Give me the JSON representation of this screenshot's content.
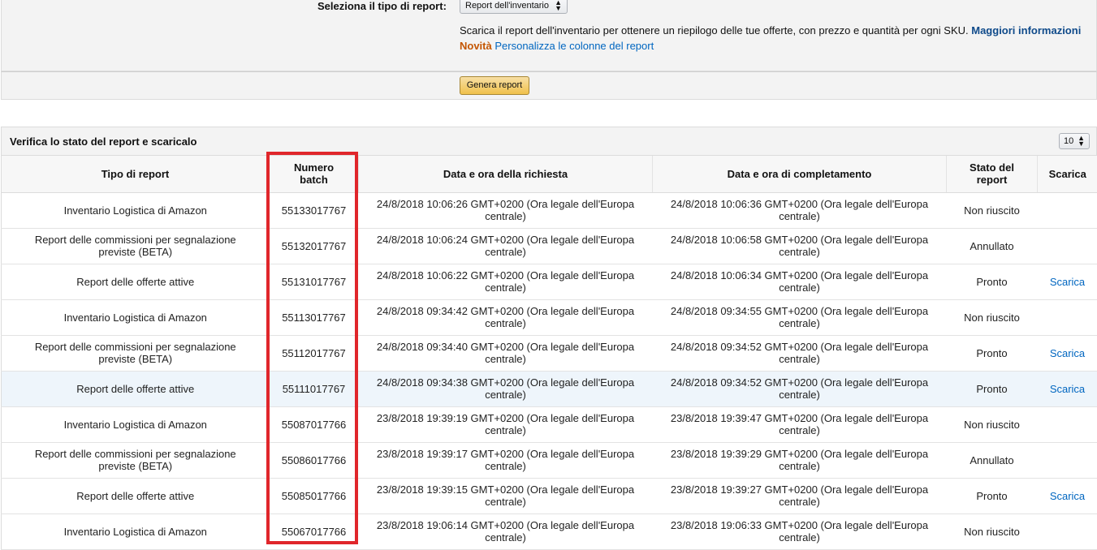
{
  "form": {
    "type_label": "Seleziona il tipo di report:",
    "type_select_value": "Report dell'inventario",
    "description": "Scarica il report dell'inventario per ottenere un riepilogo delle tue offerte, con prezzo e quantità per ogni SKU.",
    "more_info_link": "Maggiori informazioni",
    "new_badge": "Novità",
    "customize_link": "Personalizza le colonne del report",
    "generate_button": "Genera report"
  },
  "status_section": {
    "title": "Verifica lo stato del report e scaricalo",
    "page_size": "10"
  },
  "table": {
    "columns": {
      "type": "Tipo di report",
      "batch": "Numero batch",
      "requested": "Data e ora della richiesta",
      "completed": "Data e ora di completamento",
      "status": "Stato del report",
      "download": "Scarica"
    },
    "rows": [
      {
        "type": "Inventario Logistica di Amazon",
        "batch": "55133017767",
        "requested": "24/8/2018 10:06:26 GMT+0200 (Ora legale dell'Europa centrale)",
        "completed": "24/8/2018 10:06:36 GMT+0200 (Ora legale dell'Europa centrale)",
        "status": "Non riuscito",
        "download": ""
      },
      {
        "type": "Report delle commissioni per segnalazione previste (BETA)",
        "batch": "55132017767",
        "requested": "24/8/2018 10:06:24 GMT+0200 (Ora legale dell'Europa centrale)",
        "completed": "24/8/2018 10:06:58 GMT+0200 (Ora legale dell'Europa centrale)",
        "status": "Annullato",
        "download": ""
      },
      {
        "type": "Report delle offerte attive",
        "batch": "55131017767",
        "requested": "24/8/2018 10:06:22 GMT+0200 (Ora legale dell'Europa centrale)",
        "completed": "24/8/2018 10:06:34 GMT+0200 (Ora legale dell'Europa centrale)",
        "status": "Pronto",
        "download": "Scarica"
      },
      {
        "type": "Inventario Logistica di Amazon",
        "batch": "55113017767",
        "requested": "24/8/2018 09:34:42 GMT+0200 (Ora legale dell'Europa centrale)",
        "completed": "24/8/2018 09:34:55 GMT+0200 (Ora legale dell'Europa centrale)",
        "status": "Non riuscito",
        "download": ""
      },
      {
        "type": "Report delle commissioni per segnalazione previste (BETA)",
        "batch": "55112017767",
        "requested": "24/8/2018 09:34:40 GMT+0200 (Ora legale dell'Europa centrale)",
        "completed": "24/8/2018 09:34:52 GMT+0200 (Ora legale dell'Europa centrale)",
        "status": "Pronto",
        "download": "Scarica"
      },
      {
        "type": "Report delle offerte attive",
        "batch": "55111017767",
        "requested": "24/8/2018 09:34:38 GMT+0200 (Ora legale dell'Europa centrale)",
        "completed": "24/8/2018 09:34:52 GMT+0200 (Ora legale dell'Europa centrale)",
        "status": "Pronto",
        "download": "Scarica"
      },
      {
        "type": "Inventario Logistica di Amazon",
        "batch": "55087017766",
        "requested": "23/8/2018 19:39:19 GMT+0200 (Ora legale dell'Europa centrale)",
        "completed": "23/8/2018 19:39:47 GMT+0200 (Ora legale dell'Europa centrale)",
        "status": "Non riuscito",
        "download": ""
      },
      {
        "type": "Report delle commissioni per segnalazione previste (BETA)",
        "batch": "55086017766",
        "requested": "23/8/2018 19:39:17 GMT+0200 (Ora legale dell'Europa centrale)",
        "completed": "23/8/2018 19:39:29 GMT+0200 (Ora legale dell'Europa centrale)",
        "status": "Annullato",
        "download": ""
      },
      {
        "type": "Report delle offerte attive",
        "batch": "55085017766",
        "requested": "23/8/2018 19:39:15 GMT+0200 (Ora legale dell'Europa centrale)",
        "completed": "23/8/2018 19:39:27 GMT+0200 (Ora legale dell'Europa centrale)",
        "status": "Pronto",
        "download": "Scarica"
      },
      {
        "type": "Inventario Logistica di Amazon",
        "batch": "55067017766",
        "requested": "23/8/2018 19:06:14 GMT+0200 (Ora legale dell'Europa centrale)",
        "completed": "23/8/2018 19:06:33 GMT+0200 (Ora legale dell'Europa centrale)",
        "status": "Non riuscito",
        "download": ""
      }
    ]
  },
  "icons": {
    "select_arrows": "up-down-arrows-icon"
  },
  "colors": {
    "link": "#0066c0",
    "new_badge": "#c45500",
    "primary_button": "#f0c14b",
    "highlight_box": "#e0262b",
    "hover_row": "#eef5fb"
  }
}
